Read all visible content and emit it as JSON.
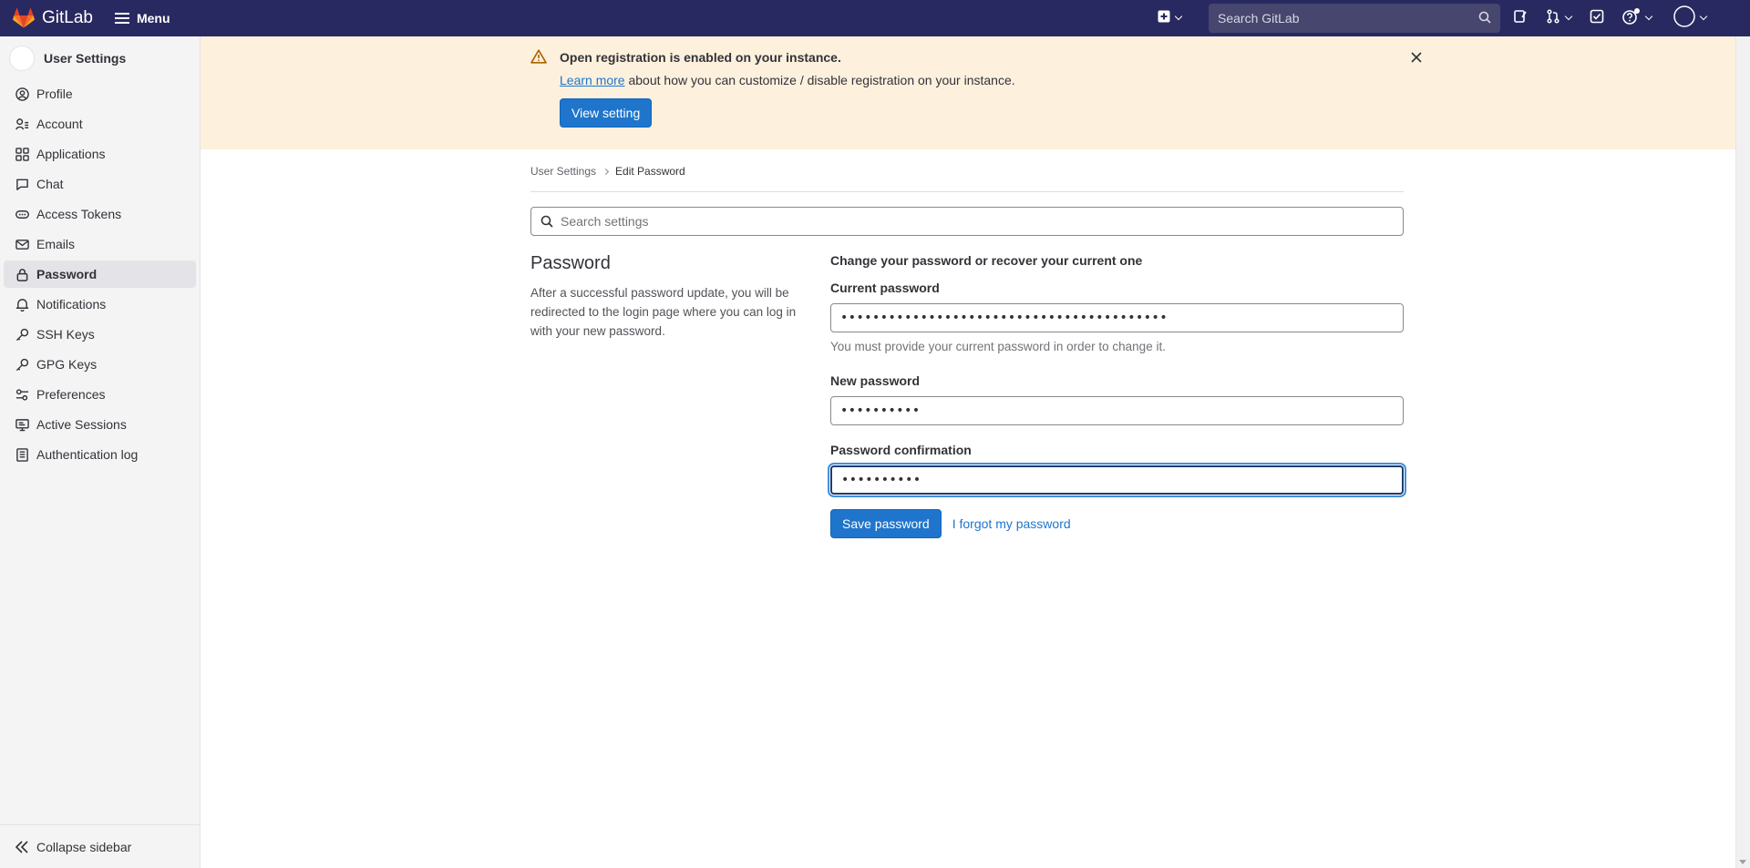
{
  "topbar": {
    "brand": "GitLab",
    "menu_label": "Menu",
    "search_placeholder": "Search GitLab"
  },
  "sidebar": {
    "title": "User Settings",
    "items": [
      {
        "label": "Profile",
        "icon": "profile-icon"
      },
      {
        "label": "Account",
        "icon": "account-icon"
      },
      {
        "label": "Applications",
        "icon": "applications-icon"
      },
      {
        "label": "Chat",
        "icon": "chat-icon"
      },
      {
        "label": "Access Tokens",
        "icon": "token-icon"
      },
      {
        "label": "Emails",
        "icon": "mail-icon"
      },
      {
        "label": "Password",
        "icon": "lock-icon",
        "active": true
      },
      {
        "label": "Notifications",
        "icon": "bell-icon"
      },
      {
        "label": "SSH Keys",
        "icon": "key-icon"
      },
      {
        "label": "GPG Keys",
        "icon": "key-icon"
      },
      {
        "label": "Preferences",
        "icon": "preferences-icon"
      },
      {
        "label": "Active Sessions",
        "icon": "monitor-icon"
      },
      {
        "label": "Authentication log",
        "icon": "log-icon"
      }
    ],
    "collapse_label": "Collapse sidebar"
  },
  "banner": {
    "title": "Open registration is enabled on your instance.",
    "link_text": "Learn more",
    "body_text": "about how you can customize / disable registration on your instance.",
    "button_label": "View setting"
  },
  "breadcrumb": {
    "parent": "User Settings",
    "current": "Edit Password"
  },
  "settings_search": {
    "placeholder": "Search settings"
  },
  "password_section": {
    "heading": "Password",
    "description": "After a successful password update, you will be redirected to the login page where you can log in with your new password.",
    "lead": "Change your password or recover your current one",
    "current_label": "Current password",
    "current_value": "•••••••••••••••••••••••••••••••••••••••••",
    "current_help": "You must provide your current password in order to change it.",
    "new_label": "New password",
    "new_value": "••••••••••",
    "confirm_label": "Password confirmation",
    "confirm_value": "••••••••••",
    "save_label": "Save password",
    "forgot_label": "I forgot my password"
  },
  "colors": {
    "navbar": "#292961",
    "banner_bg": "#fdf1dd",
    "primary": "#1f75cb"
  }
}
